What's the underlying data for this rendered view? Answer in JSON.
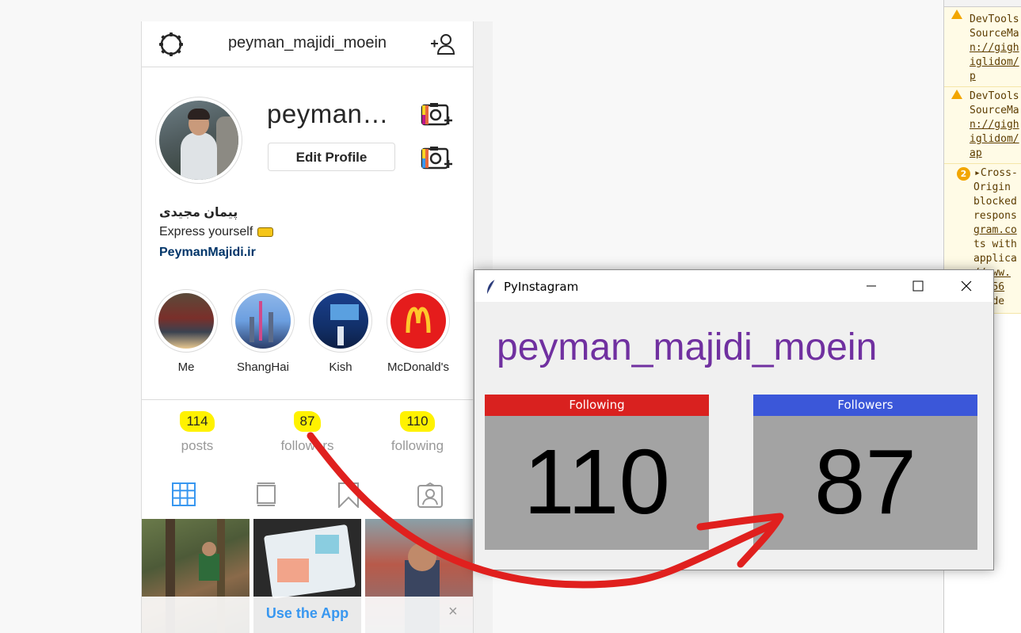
{
  "instagram": {
    "header": {
      "username": "peyman_majidi_moein",
      "settings_icon": "gear-icon",
      "add_user_icon": "add-user-icon"
    },
    "profile": {
      "display_name": "peyman…",
      "edit_button": "Edit Profile",
      "full_name": "پیمان مجیدی",
      "bio": "Express yourself",
      "link": "PeymanMajidi.ir"
    },
    "highlights": [
      {
        "label": "Me"
      },
      {
        "label": "ShangHai"
      },
      {
        "label": "Kish"
      },
      {
        "label": "McDonald's"
      }
    ],
    "stats": [
      {
        "value": "114",
        "label": "posts"
      },
      {
        "value": "87",
        "label": "followers"
      },
      {
        "value": "110",
        "label": "following"
      }
    ],
    "tabs": [
      "grid-icon",
      "feed-icon",
      "saved-icon",
      "tagged-icon"
    ],
    "app_banner": {
      "text": "Use the App",
      "close": "×"
    }
  },
  "devtools": {
    "messages": [
      {
        "type": "warning",
        "lines": [
          "DevTools",
          "SourceMa",
          "n://gigh",
          "iglidom/",
          "p"
        ]
      },
      {
        "type": "warning",
        "lines": [
          "DevTools",
          "SourceMa",
          "n://gigh",
          "iglidom/",
          "ap"
        ]
      },
      {
        "type": "error-group",
        "count": "2",
        "lines": [
          "▸Cross-",
          "Origin",
          "blocked",
          "respons",
          "gram.co",
          "ts with",
          "applica",
          "//www.",
          "re/56",
          "he de"
        ]
      }
    ]
  },
  "pyinstagram": {
    "window_title": "PyInstagram",
    "username": "peyman_majidi_moein",
    "following": {
      "label": "Following",
      "value": "110",
      "color": "#d9211f"
    },
    "followers": {
      "label": "Followers",
      "value": "87",
      "color": "#3b57d9"
    }
  },
  "colors": {
    "highlight_marker": "#fff200",
    "annotation_arrow": "#e0201e",
    "username_purple": "#7030a0",
    "instagram_link": "#003569",
    "instagram_blue": "#3897f0"
  }
}
